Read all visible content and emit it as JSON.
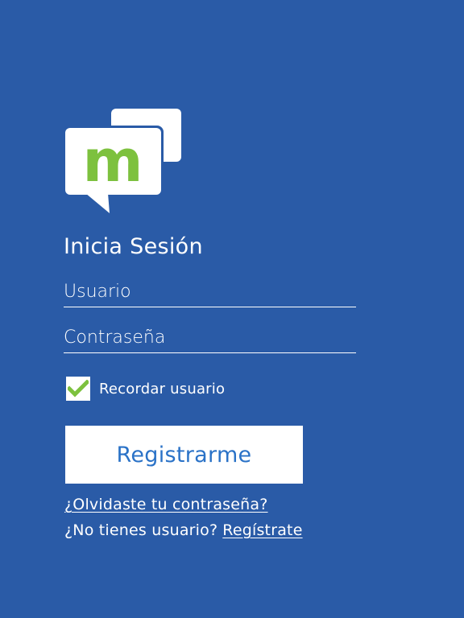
{
  "app": {
    "logo_letter": "m"
  },
  "colors": {
    "background": "#2a5ba7",
    "logo_green": "#7dc13e",
    "button_text": "#2a72c7",
    "checkmark": "#7dc13e"
  },
  "login": {
    "title": "Inicia Sesión",
    "username_placeholder": "Usuario",
    "username_value": "",
    "password_placeholder": "Contraseña",
    "password_value": "",
    "remember_label": "Recordar usuario",
    "remember_checked": true,
    "submit_label": "Registrarme",
    "forgot_link": "¿Olvidaste tu contraseña?",
    "signup_prompt": "¿No tienes usuario?",
    "signup_link": "Regístrate"
  }
}
